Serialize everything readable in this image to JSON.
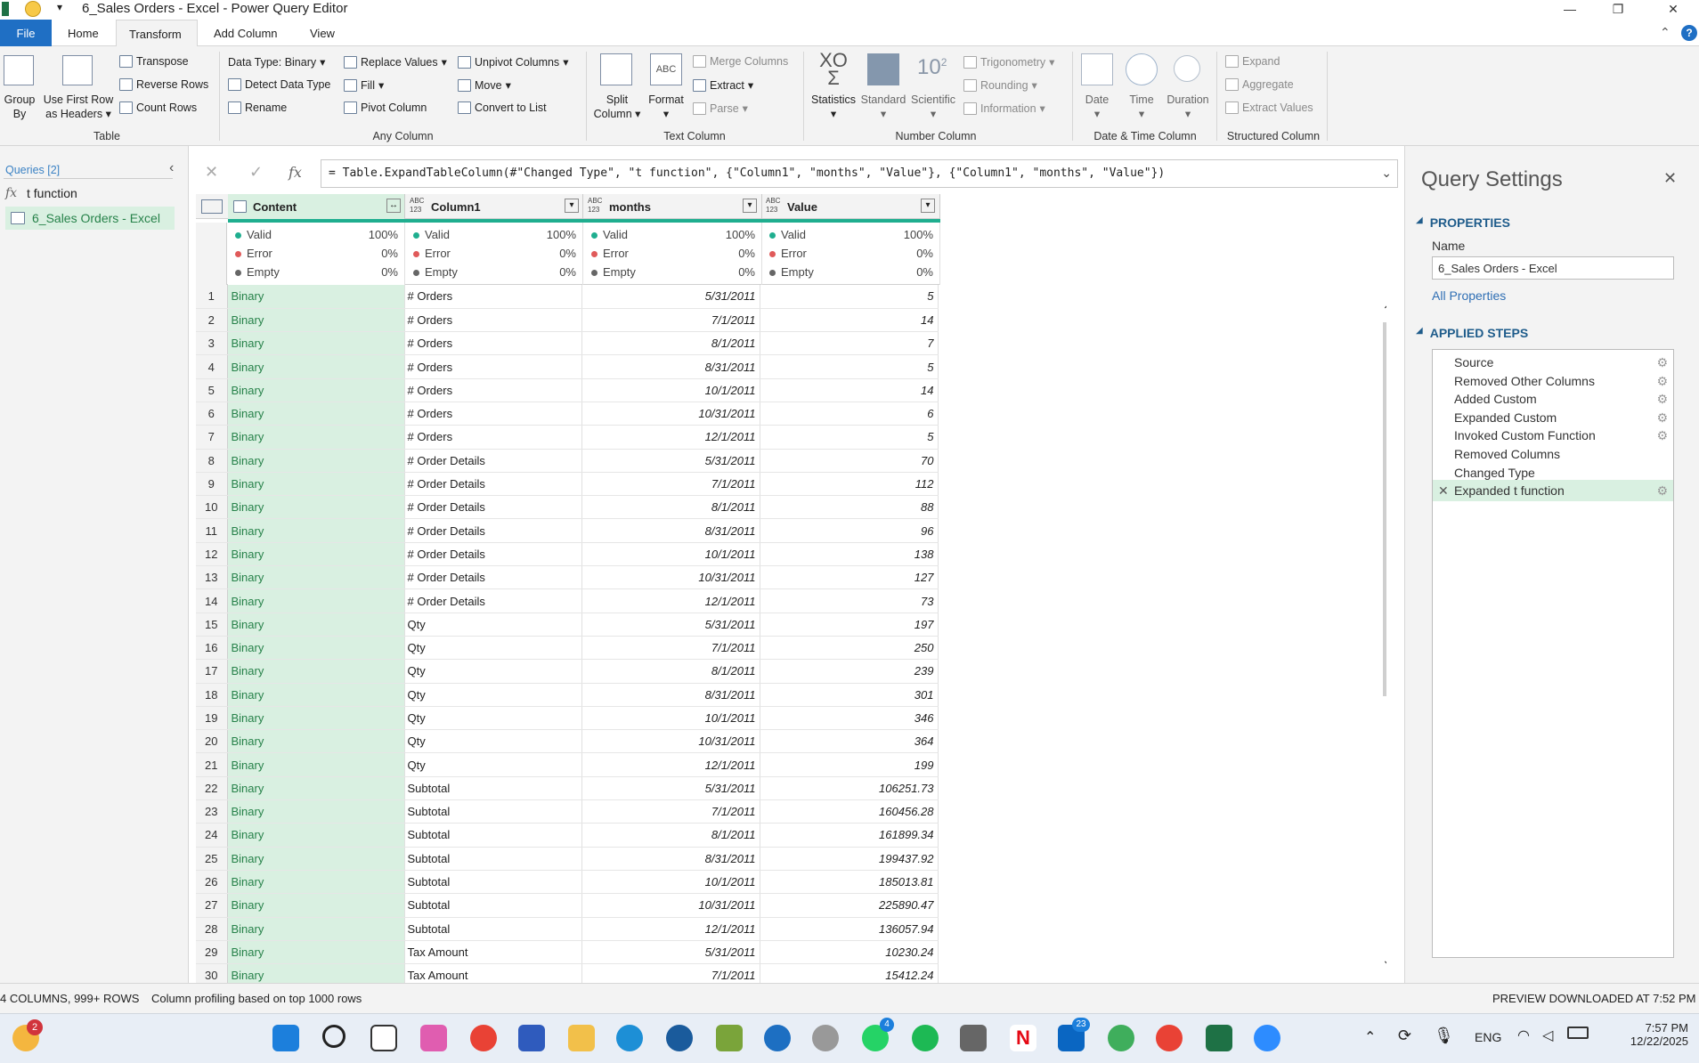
{
  "window": {
    "title": "6_Sales Orders - Excel - Power Query Editor"
  },
  "tabs": [
    "File",
    "Home",
    "Transform",
    "Add Column",
    "View"
  ],
  "ribbon": {
    "table": {
      "group_by_1": "Group",
      "group_by_2": "By",
      "use_first_row_1": "Use First Row",
      "use_first_row_2": "as Headers",
      "transpose": "Transpose",
      "reverse_rows": "Reverse Rows",
      "count_rows": "Count Rows",
      "label": "Table"
    },
    "any_column": {
      "data_type": "Data Type: Binary",
      "detect": "Detect Data Type",
      "rename": "Rename",
      "replace": "Replace Values",
      "fill": "Fill",
      "pivot": "Pivot Column",
      "unpivot": "Unpivot Columns",
      "move": "Move",
      "convert": "Convert to List",
      "label": "Any Column"
    },
    "text_column": {
      "split_1": "Split",
      "split_2": "Column",
      "format": "Format",
      "merge": "Merge Columns",
      "extract": "Extract",
      "parse": "Parse",
      "label": "Text Column"
    },
    "number_column": {
      "statistics": "Statistics",
      "standard": "Standard",
      "scientific": "Scientific",
      "trig": "Trigonometry",
      "rounding": "Rounding",
      "information": "Information",
      "label": "Number Column",
      "xo": "XO",
      "ten": "10"
    },
    "datetime": {
      "date": "Date",
      "time": "Time",
      "duration": "Duration",
      "label": "Date & Time Column"
    },
    "structured": {
      "expand": "Expand",
      "aggregate": "Aggregate",
      "extract_values": "Extract Values",
      "label": "Structured Column"
    }
  },
  "queries": {
    "header": "Queries [2]",
    "items": [
      "t function",
      "6_Sales Orders - Excel"
    ]
  },
  "formula": "= Table.ExpandTableColumn(#\"Changed Type\", \"t function\", {\"Column1\", \"months\", \"Value\"}, {\"Column1\", \"months\", \"Value\"})",
  "columns": [
    {
      "name": "Content",
      "type": ""
    },
    {
      "name": "Column1",
      "type": "ABC 123"
    },
    {
      "name": "months",
      "type": "ABC 123"
    },
    {
      "name": "Value",
      "type": "ABC 123"
    }
  ],
  "profile": {
    "valid": "Valid",
    "error": "Error",
    "empty": "Empty",
    "valid_pct": "100%",
    "error_pct": "0%",
    "empty_pct": "0%"
  },
  "rows": [
    [
      "1",
      "Binary",
      "# Orders",
      "5/31/2011",
      "5"
    ],
    [
      "2",
      "Binary",
      "# Orders",
      "7/1/2011",
      "14"
    ],
    [
      "3",
      "Binary",
      "# Orders",
      "8/1/2011",
      "7"
    ],
    [
      "4",
      "Binary",
      "# Orders",
      "8/31/2011",
      "5"
    ],
    [
      "5",
      "Binary",
      "# Orders",
      "10/1/2011",
      "14"
    ],
    [
      "6",
      "Binary",
      "# Orders",
      "10/31/2011",
      "6"
    ],
    [
      "7",
      "Binary",
      "# Orders",
      "12/1/2011",
      "5"
    ],
    [
      "8",
      "Binary",
      "# Order Details",
      "5/31/2011",
      "70"
    ],
    [
      "9",
      "Binary",
      "# Order Details",
      "7/1/2011",
      "112"
    ],
    [
      "10",
      "Binary",
      "# Order Details",
      "8/1/2011",
      "88"
    ],
    [
      "11",
      "Binary",
      "# Order Details",
      "8/31/2011",
      "96"
    ],
    [
      "12",
      "Binary",
      "# Order Details",
      "10/1/2011",
      "138"
    ],
    [
      "13",
      "Binary",
      "# Order Details",
      "10/31/2011",
      "127"
    ],
    [
      "14",
      "Binary",
      "# Order Details",
      "12/1/2011",
      "73"
    ],
    [
      "15",
      "Binary",
      "Qty",
      "5/31/2011",
      "197"
    ],
    [
      "16",
      "Binary",
      "Qty",
      "7/1/2011",
      "250"
    ],
    [
      "17",
      "Binary",
      "Qty",
      "8/1/2011",
      "239"
    ],
    [
      "18",
      "Binary",
      "Qty",
      "8/31/2011",
      "301"
    ],
    [
      "19",
      "Binary",
      "Qty",
      "10/1/2011",
      "346"
    ],
    [
      "20",
      "Binary",
      "Qty",
      "10/31/2011",
      "364"
    ],
    [
      "21",
      "Binary",
      "Qty",
      "12/1/2011",
      "199"
    ],
    [
      "22",
      "Binary",
      "Subtotal",
      "5/31/2011",
      "106251.73"
    ],
    [
      "23",
      "Binary",
      "Subtotal",
      "7/1/2011",
      "160456.28"
    ],
    [
      "24",
      "Binary",
      "Subtotal",
      "8/1/2011",
      "161899.34"
    ],
    [
      "25",
      "Binary",
      "Subtotal",
      "8/31/2011",
      "199437.92"
    ],
    [
      "26",
      "Binary",
      "Subtotal",
      "10/1/2011",
      "185013.81"
    ],
    [
      "27",
      "Binary",
      "Subtotal",
      "10/31/2011",
      "225890.47"
    ],
    [
      "28",
      "Binary",
      "Subtotal",
      "12/1/2011",
      "136057.94"
    ],
    [
      "29",
      "Binary",
      "Tax Amount",
      "5/31/2011",
      "10230.24"
    ],
    [
      "30",
      "Binary",
      "Tax Amount",
      "7/1/2011",
      "15412.24"
    ]
  ],
  "query_settings": {
    "title": "Query Settings",
    "properties": "PROPERTIES",
    "name_label": "Name",
    "name_value": "6_Sales Orders - Excel",
    "all_properties": "All Properties",
    "applied_steps": "APPLIED STEPS",
    "steps": [
      "Source",
      "Removed Other Columns",
      "Added Custom",
      "Expanded Custom",
      "Invoked Custom Function",
      "Removed Columns",
      "Changed Type",
      "Expanded t function"
    ]
  },
  "status": {
    "left": "4 COLUMNS, 999+ ROWS",
    "profiling": "Column profiling based on top 1000 rows",
    "right": "PREVIEW DOWNLOADED AT 7:52 PM"
  },
  "taskbar": {
    "lang": "ENG",
    "time": "7:57 PM",
    "date": "12/22/2025",
    "badge_weather": "2",
    "badge_whatsapp": "4",
    "badge_linkedin": "23"
  },
  "colors": {
    "accent": "#1f6fc4",
    "content_bg": "#d9f0e1",
    "valid": "#1fae8f",
    "error": "#e05a5a",
    "selected_step": "#d9f0e1"
  }
}
